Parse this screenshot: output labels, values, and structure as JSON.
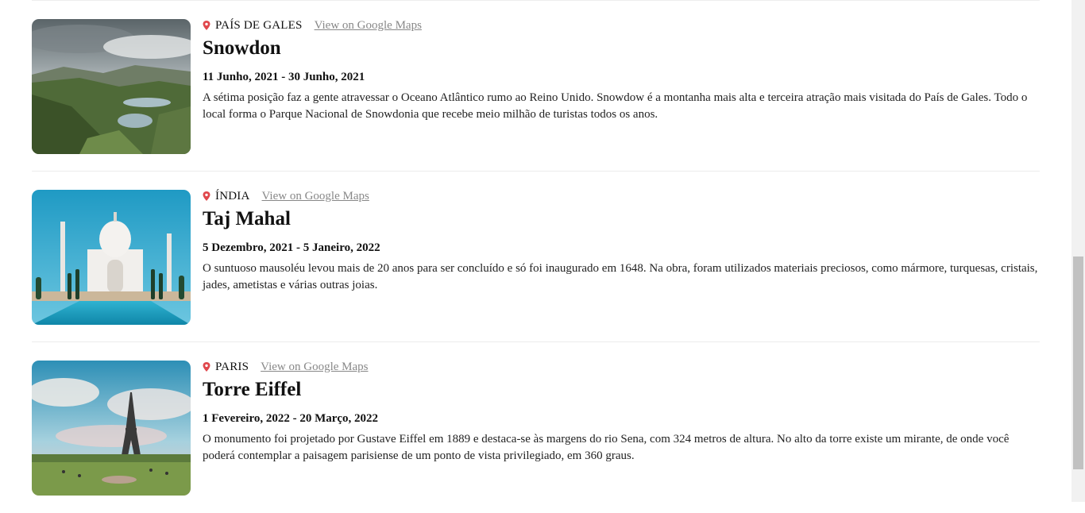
{
  "entries": [
    {
      "country": "PAÍS DE GALES",
      "maps_link": "View on Google Maps",
      "title": "Snowdon",
      "dates": "11 Junho, 2021 - 30 Junho, 2021",
      "description": "A sétima posição faz a gente atravessar o Oceano Atlântico rumo ao Reino Unido. Snowdow é a montanha mais alta e terceira atração mais visitada do País de Gales. Todo o local forma o Parque Nacional de Snowdonia que recebe meio milhão de turistas todos os anos.",
      "image": "snowdon-landscape-photo"
    },
    {
      "country": "ÍNDIA",
      "maps_link": "View on Google Maps",
      "title": "Taj Mahal",
      "dates": "5 Dezembro, 2021 - 5 Janeiro, 2022",
      "description": "O suntuoso mausoléu levou mais de 20 anos para ser concluído e só foi inaugurado em 1648. Na obra, foram utilizados materiais preciosos, como mármore, turquesas, cristais, jades, ametistas e várias outras joias.",
      "image": "taj-mahal-photo"
    },
    {
      "country": "PARIS",
      "maps_link": "View on Google Maps",
      "title": "Torre Eiffel",
      "dates": "1 Fevereiro, 2022 - 20 Março, 2022",
      "description": "O monumento foi projetado por Gustave Eiffel em 1889 e destaca-se às margens do rio Sena, com 324 metros de altura. No alto da torre existe um mirante, de onde você poderá contemplar a paisagem parisiense de um ponto de vista privilegiado, em 360 graus.",
      "image": "eiffel-tower-photo"
    }
  ],
  "colors": {
    "pin": "#e0474c",
    "link": "#888888",
    "divider": "#ececec"
  },
  "icons": {
    "location": "map-pin-icon"
  }
}
